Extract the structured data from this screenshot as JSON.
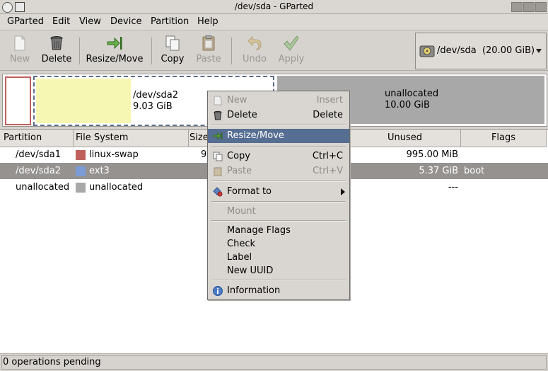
{
  "window": {
    "title": "/dev/sda - GParted"
  },
  "menubar": [
    {
      "label": "GParted"
    },
    {
      "label": "Edit"
    },
    {
      "label": "View"
    },
    {
      "label": "Device"
    },
    {
      "label": "Partition"
    },
    {
      "label": "Help"
    }
  ],
  "toolbar": {
    "new_label": "New",
    "delete_label": "Delete",
    "resize_label": "Resize/Move",
    "copy_label": "Copy",
    "paste_label": "Paste",
    "undo_label": "Undo",
    "apply_label": "Apply"
  },
  "device_selector": {
    "device": "/dev/sda",
    "size": "(20.00 GiB)"
  },
  "graph": {
    "sda2": {
      "name": "/dev/sda2",
      "size": "9.03 GiB"
    },
    "unallocated": {
      "name": "unallocated",
      "size": "10.00 GiB"
    }
  },
  "table": {
    "columns": [
      "Partition",
      "File System",
      "Size",
      "Unused",
      "Flags"
    ],
    "rows": [
      {
        "partition": "/dev/sda1",
        "filesystem": "linux-swap",
        "fs_color": "#c0605c",
        "size": "9",
        "unused": "995.00 MiB",
        "flags": ""
      },
      {
        "partition": "/dev/sda2",
        "filesystem": "ext3",
        "fs_color": "#7b9ad6",
        "size": "",
        "unused": "5.37 GiB",
        "flags": "boot"
      },
      {
        "partition": "unallocated",
        "filesystem": "unallocated",
        "fs_color": "#a8a8a8",
        "size": "",
        "unused": "---",
        "flags": ""
      }
    ]
  },
  "context_menu": {
    "new": {
      "label": "New",
      "accel": "Insert"
    },
    "delete": {
      "label": "Delete",
      "accel": "Delete"
    },
    "resize": {
      "label": "Resize/Move"
    },
    "copy": {
      "label": "Copy",
      "accel": "Ctrl+C"
    },
    "paste": {
      "label": "Paste",
      "accel": "Ctrl+V"
    },
    "format": {
      "label": "Format to"
    },
    "mount": {
      "label": "Mount"
    },
    "flags": {
      "label": "Manage Flags"
    },
    "check": {
      "label": "Check"
    },
    "label": {
      "label": "Label"
    },
    "uuid": {
      "label": "New UUID"
    },
    "info": {
      "label": "Information"
    }
  },
  "status": {
    "text": "0 operations pending"
  },
  "colors": {
    "highlight": "#566e92",
    "selected_row": "#959290",
    "ext3": "#7b9ad6",
    "swap": "#c0605c",
    "sda2_fill": "#f7f7b4"
  }
}
